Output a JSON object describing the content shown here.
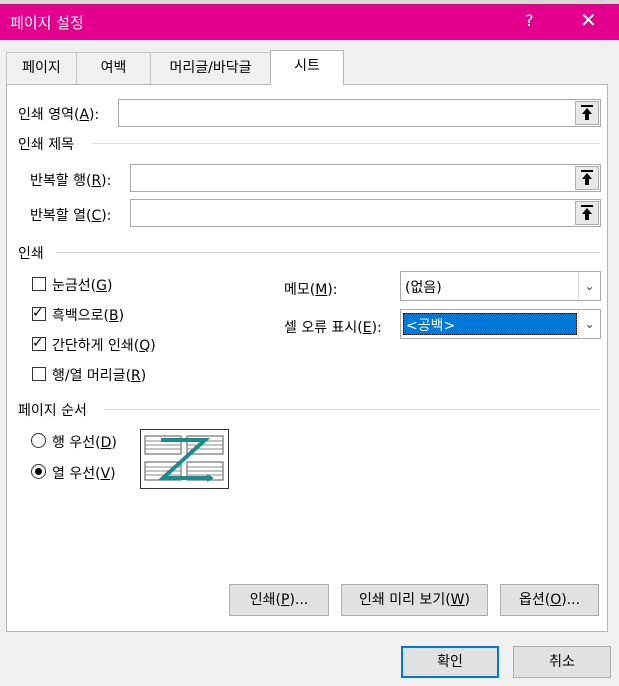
{
  "window": {
    "title": "페이지 설정",
    "help_glyph": "?",
    "close_glyph": "✕"
  },
  "tabs": [
    {
      "label": "페이지",
      "active": false
    },
    {
      "label": "여백",
      "active": false
    },
    {
      "label": "머리글/바닥글",
      "active": false
    },
    {
      "label": "시트",
      "active": true
    }
  ],
  "print_area": {
    "label_pre": "인쇄 영역(",
    "key": "A",
    "label_post": "):",
    "value": ""
  },
  "print_titles": {
    "section": "인쇄 제목",
    "rows": {
      "label_pre": "반복할 행(",
      "key": "R",
      "label_post": "):",
      "value": ""
    },
    "cols": {
      "label_pre": "반복할 열(",
      "key": "C",
      "label_post": "):",
      "value": ""
    }
  },
  "print": {
    "section": "인쇄",
    "gridlines": {
      "label_pre": "눈금선(",
      "key": "G",
      "label_post": ")",
      "checked": false
    },
    "black_white": {
      "label_pre": "흑백으로(",
      "key": "B",
      "label_post": ")",
      "checked": true
    },
    "draft": {
      "label_pre": "간단하게 인쇄(",
      "key": "Q",
      "label_post": ")",
      "checked": true
    },
    "headings": {
      "label_pre": "행/열 머리글(",
      "key": "R",
      "label_post": ")",
      "checked": false
    },
    "comments": {
      "label_pre": "메모(",
      "key": "M",
      "label_post": "):",
      "value": "(없음)"
    },
    "cell_errors": {
      "label_pre": "셀 오류 표시(",
      "key": "E",
      "label_post": "):",
      "value": "<공백>"
    }
  },
  "page_order": {
    "section": "페이지 순서",
    "down_then_over": {
      "label_pre": "행 우선(",
      "key": "D",
      "label_post": ")",
      "selected": false
    },
    "over_then_down": {
      "label_pre": "열 우선(",
      "key": "V",
      "label_post": ")",
      "selected": true
    }
  },
  "buttons": {
    "print": {
      "label_pre": "인쇄(",
      "key": "P",
      "label_post": ")..."
    },
    "preview": {
      "label_pre": "인쇄 미리 보기(",
      "key": "W",
      "label_post": ")"
    },
    "options": {
      "label_pre": "옵션(",
      "key": "O",
      "label_post": ")..."
    },
    "ok": "확인",
    "cancel": "취소"
  },
  "colors": {
    "titlebar": "#e3008c",
    "focus": "#0078d7",
    "arrow": "#1b8a8a"
  },
  "icons": {
    "pick": "collapse-dialog-icon",
    "dropdown": "chevron-down-icon"
  }
}
